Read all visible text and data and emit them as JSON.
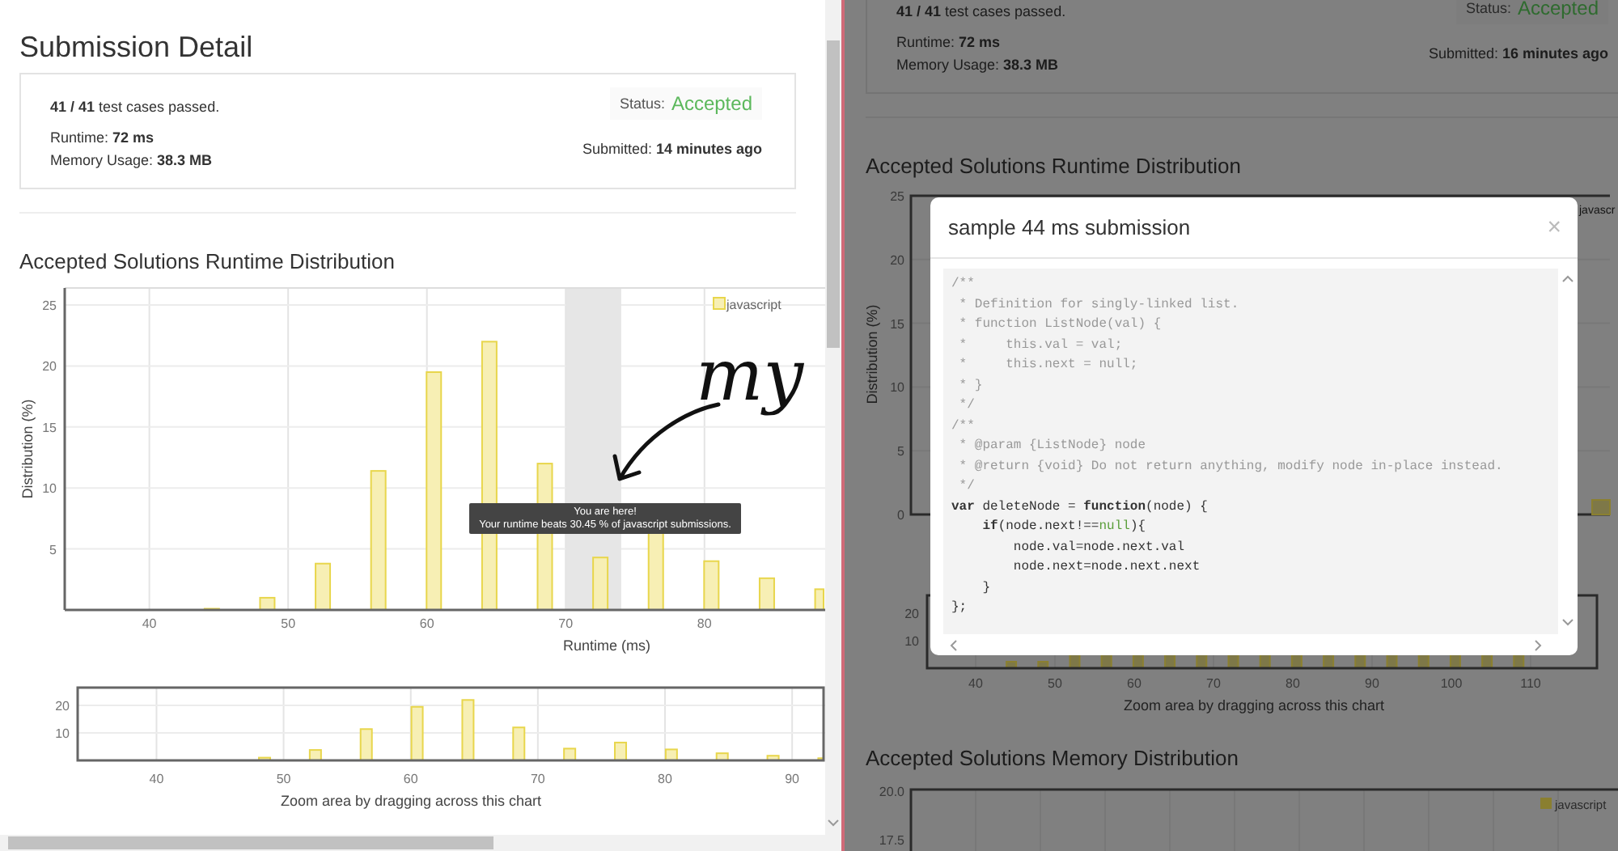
{
  "left_pane": {
    "title": "Submission Detail",
    "summary": {
      "cases": "**41 / 41** test cases passed.",
      "runtime": "Runtime: **72 ms**",
      "memory": "Memory Usage: **38.3 MB**",
      "status_label": "Status:",
      "status": "Accepted",
      "submitted": "Submitted: **14 minutes ago**"
    },
    "runtime_title": "Accepted Solutions Runtime Distribution",
    "runtime_chart": {
      "chart_data": {
        "type": "bar",
        "xlabel": "Runtime (ms)",
        "ylabel": "Distribution (%)",
        "x": [
          44.5,
          48.5,
          52.5,
          56.5,
          60.5,
          64.5,
          68.5,
          72.5,
          76.5,
          80.5,
          84.5,
          88.5
        ],
        "series": [
          {
            "name": "javascript",
            "color": "#f7efb4",
            "values": [
              0.1,
              1,
              3.8,
              11.4,
              19.5,
              22,
              12,
              4.3,
              6.5,
              4,
              2.6,
              1.7
            ]
          }
        ],
        "xlim": [
          33.9,
          88.7
        ],
        "ylim": [
          0,
          26.4
        ],
        "xticks": [
          40,
          50,
          60,
          70,
          80
        ],
        "yticks": [
          5,
          10,
          15,
          20,
          25
        ],
        "grid": true,
        "bands": [
          {
            "axis": "x",
            "from": 70,
            "to": 74
          }
        ]
      },
      "tooltip": {
        "title": "You are here!",
        "text": "Your runtime beats 30.45 % of javascript submissions."
      },
      "handwritten_note": "my"
    },
    "zoom_chart": {
      "chart_data": {
        "type": "bar",
        "xlabel": "Zoom area by dragging across this chart",
        "x": [
          48.5,
          52.5,
          56.5,
          60.5,
          64.5,
          68.5,
          72.5,
          76.5,
          80.5,
          84.5,
          88.5,
          92.5
        ],
        "series": [
          {
            "color": "#f7efb4",
            "values": [
              1,
              3.8,
              11.4,
              19.5,
              22,
              12,
              4.3,
              6.5,
              4,
              2.6,
              1.7,
              0.8
            ]
          }
        ],
        "xlim": [
          33.8,
          92.6
        ],
        "ylim": [
          0,
          26.5
        ],
        "xticks": [
          40,
          50,
          60,
          70,
          80,
          90
        ],
        "yticks": [
          10,
          20
        ],
        "grid": true
      }
    }
  },
  "right_pane": {
    "summary": {
      "cases": "**41 / 41** test cases passed.",
      "runtime": "Runtime: **72 ms**",
      "memory": "Memory Usage: **38.3 MB**",
      "status_label": "Status:",
      "status": "Accepted",
      "submitted": "Submitted: **16 minutes ago**"
    },
    "runtime_title": "Accepted Solutions Runtime Distribution",
    "runtime_chart": {
      "ylabel": "Distribution (%)",
      "yticks": [
        "25",
        "20",
        "15",
        "10",
        "5",
        "0"
      ],
      "legend": "javascr"
    },
    "zoom_chart": {
      "yticks": [
        "20",
        "10"
      ],
      "xticks": [
        "40",
        "50",
        "60",
        "70",
        "80",
        "90",
        "100",
        "110"
      ],
      "caption": "Zoom area by dragging across this chart"
    },
    "memory_title": "Accepted Solutions Memory Distribution",
    "memory_chart": {
      "yticks": [
        "20.0",
        "17.5"
      ],
      "legend": "javascript"
    },
    "modal": {
      "title": "sample 44 ms submission",
      "close": "×",
      "code": [
        [
          {
            "kind": "comment",
            "text": "/**"
          }
        ],
        [
          {
            "kind": "comment",
            "text": " * Definition for singly-linked list."
          }
        ],
        [
          {
            "kind": "comment",
            "text": " * function ListNode(val) {"
          }
        ],
        [
          {
            "kind": "comment",
            "text": " *     this.val = val;"
          }
        ],
        [
          {
            "kind": "comment",
            "text": " *     this.next = null;"
          }
        ],
        [
          {
            "kind": "comment",
            "text": " * }"
          }
        ],
        [
          {
            "kind": "comment",
            "text": " */"
          }
        ],
        [
          {
            "kind": "comment",
            "text": "/**"
          }
        ],
        [
          {
            "kind": "comment",
            "text": " * @param {ListNode} node"
          }
        ],
        [
          {
            "kind": "comment",
            "text": " * @return {void} Do not return anything, modify node in-place instead."
          }
        ],
        [
          {
            "kind": "comment",
            "text": " */"
          }
        ],
        [
          {
            "kind": "keyword",
            "text": "var"
          },
          {
            "kind": "plain",
            "text": " deleteNode = "
          },
          {
            "kind": "keyword",
            "text": "function"
          },
          {
            "kind": "plain",
            "text": "(node) {"
          }
        ],
        [
          {
            "kind": "keyword",
            "text": "    if"
          },
          {
            "kind": "plain",
            "text": "(node.next!=="
          },
          {
            "kind": "literal",
            "text": "null"
          },
          {
            "kind": "plain",
            "text": "){"
          }
        ],
        [
          {
            "kind": "plain",
            "text": "        node.val=node.next.val"
          }
        ],
        [
          {
            "kind": "plain",
            "text": "        node.next=node.next.next"
          }
        ],
        [
          {
            "kind": "plain",
            "text": "    }"
          }
        ],
        [
          {
            "kind": "plain",
            "text": "};"
          }
        ]
      ]
    }
  }
}
